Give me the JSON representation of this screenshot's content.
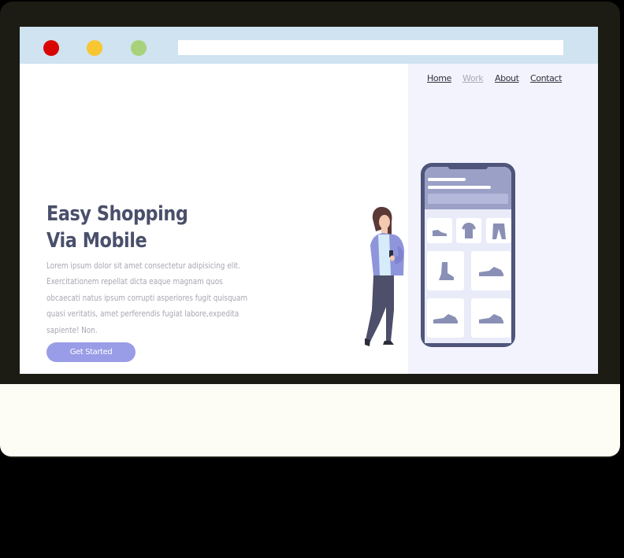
{
  "nav": {
    "items": [
      {
        "label": "Home"
      },
      {
        "label": "Work"
      },
      {
        "label": "About"
      },
      {
        "label": "Contact"
      }
    ]
  },
  "hero": {
    "title_line1": "Easy Shopping",
    "title_line2": "Via Mobile",
    "body": "Lorem ipsum dolor sit amet consectetur adipisicing elit. Exercitationem repellat dicta eaque magnam quos obcaecati natus ipsum corrupti asperiores fugit quisquam quasi veritatis, amet perferendis fugiat labore,expedita sapiente! Non.",
    "cta_label": "Get Started"
  },
  "colors": {
    "accent": "#999ce6",
    "phone_frame": "#4f557a",
    "phone_header": "#9aa0c6",
    "panel_bg": "#f3f3fd"
  },
  "icons": [
    "shoe-icon",
    "tshirt-icon",
    "pants-icon",
    "boot-icon",
    "sneaker-icon"
  ]
}
